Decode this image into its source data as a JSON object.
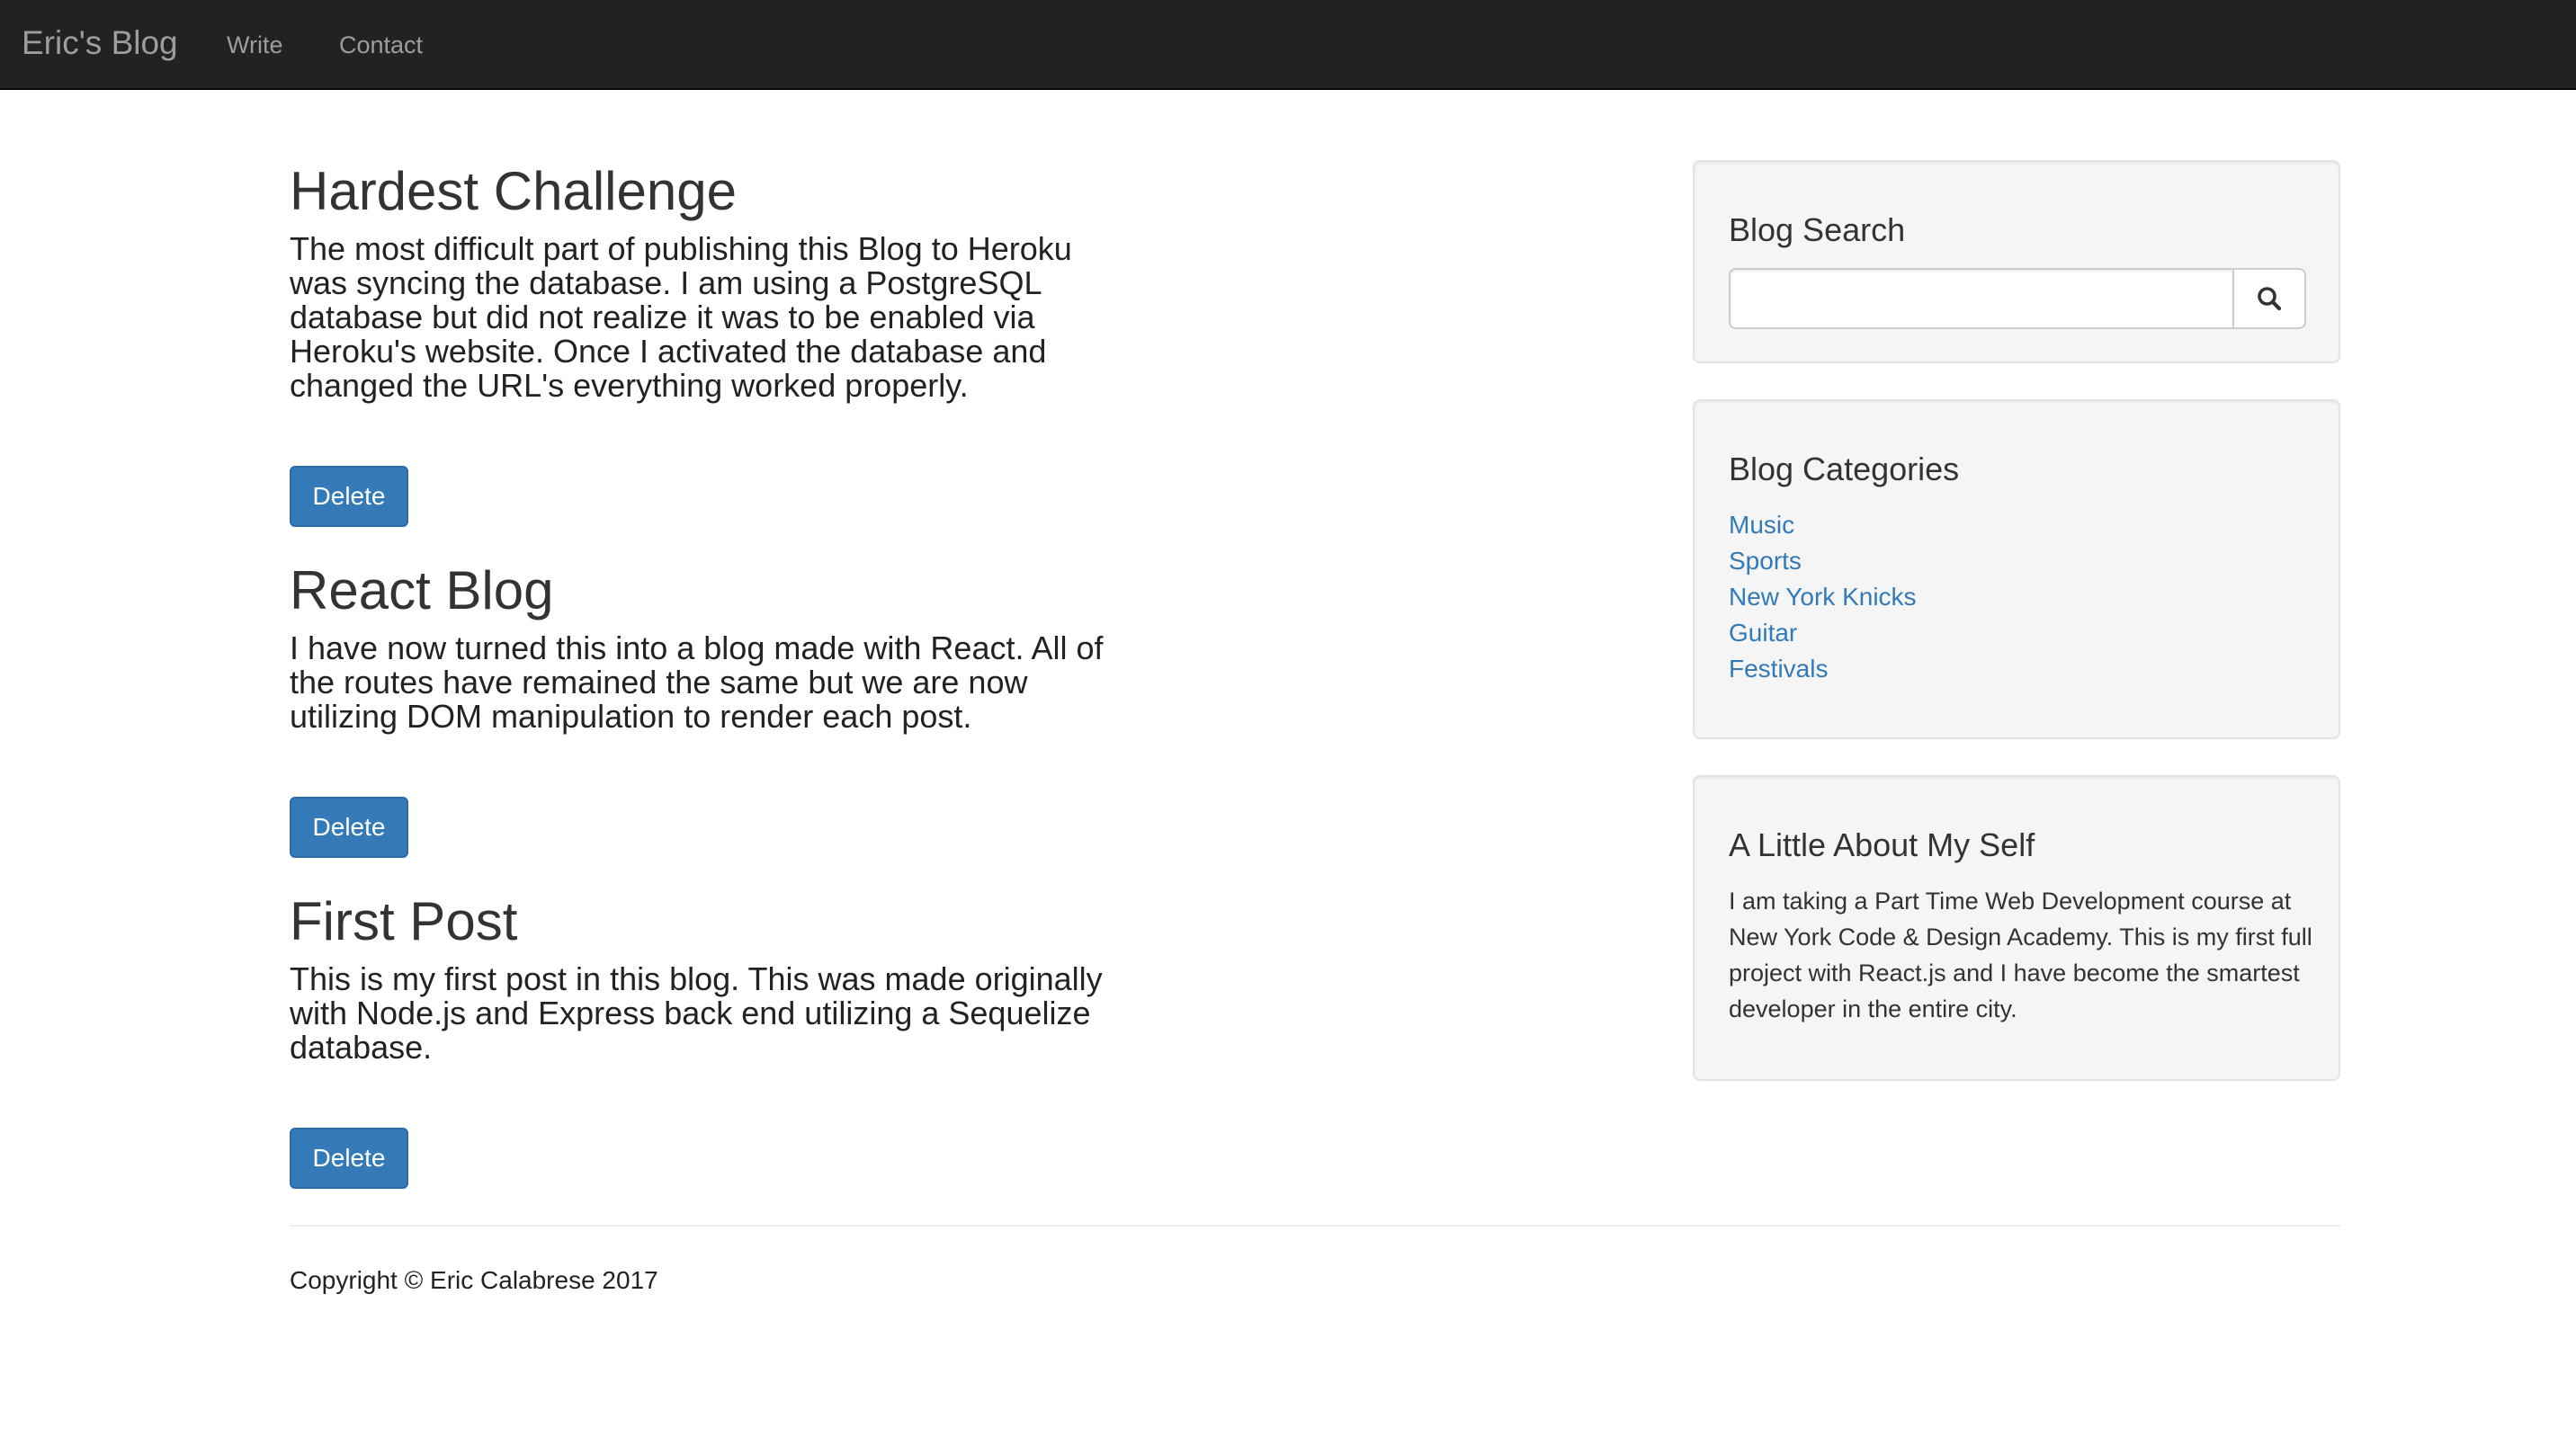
{
  "navbar": {
    "brand": "Eric's Blog",
    "links": [
      "Write",
      "Contact"
    ]
  },
  "posts": [
    {
      "title": "Hardest Challenge",
      "body": "The most difficult part of publishing this Blog to Heroku was syncing the database. I am using a PostgreSQL database but did not realize it was to be enabled via Heroku's website. Once I activated the database and changed the URL's everything worked properly.",
      "delete_label": "Delete"
    },
    {
      "title": "React Blog",
      "body": "I have now turned this into a blog made with React. All of the routes have remained the same but we are now utilizing DOM manipulation to render each post.",
      "delete_label": "Delete"
    },
    {
      "title": "First Post",
      "body": "This is my first post in this blog. This was made originally with Node.js and Express back end utilizing a Sequelize database.",
      "delete_label": "Delete"
    }
  ],
  "sidebar": {
    "search": {
      "title": "Blog Search",
      "placeholder": "",
      "value": "",
      "button_icon": "search-icon"
    },
    "categories": {
      "title": "Blog Categories",
      "items": [
        "Music",
        "Sports",
        "New York Knicks",
        "Guitar",
        "Festivals"
      ]
    },
    "about": {
      "title": "A Little About My Self",
      "text": "I am taking a Part Time Web Development course at New York Code & Design Academy. This is my first full project with React.js and I have become the smartest developer in the entire city."
    }
  },
  "footer": {
    "copyright": "Copyright © Eric Calabrese 2017"
  },
  "colors": {
    "navbar_bg": "#222222",
    "nav_text": "#9d9d9d",
    "primary": "#337ab7",
    "well_bg": "#f5f5f5"
  }
}
